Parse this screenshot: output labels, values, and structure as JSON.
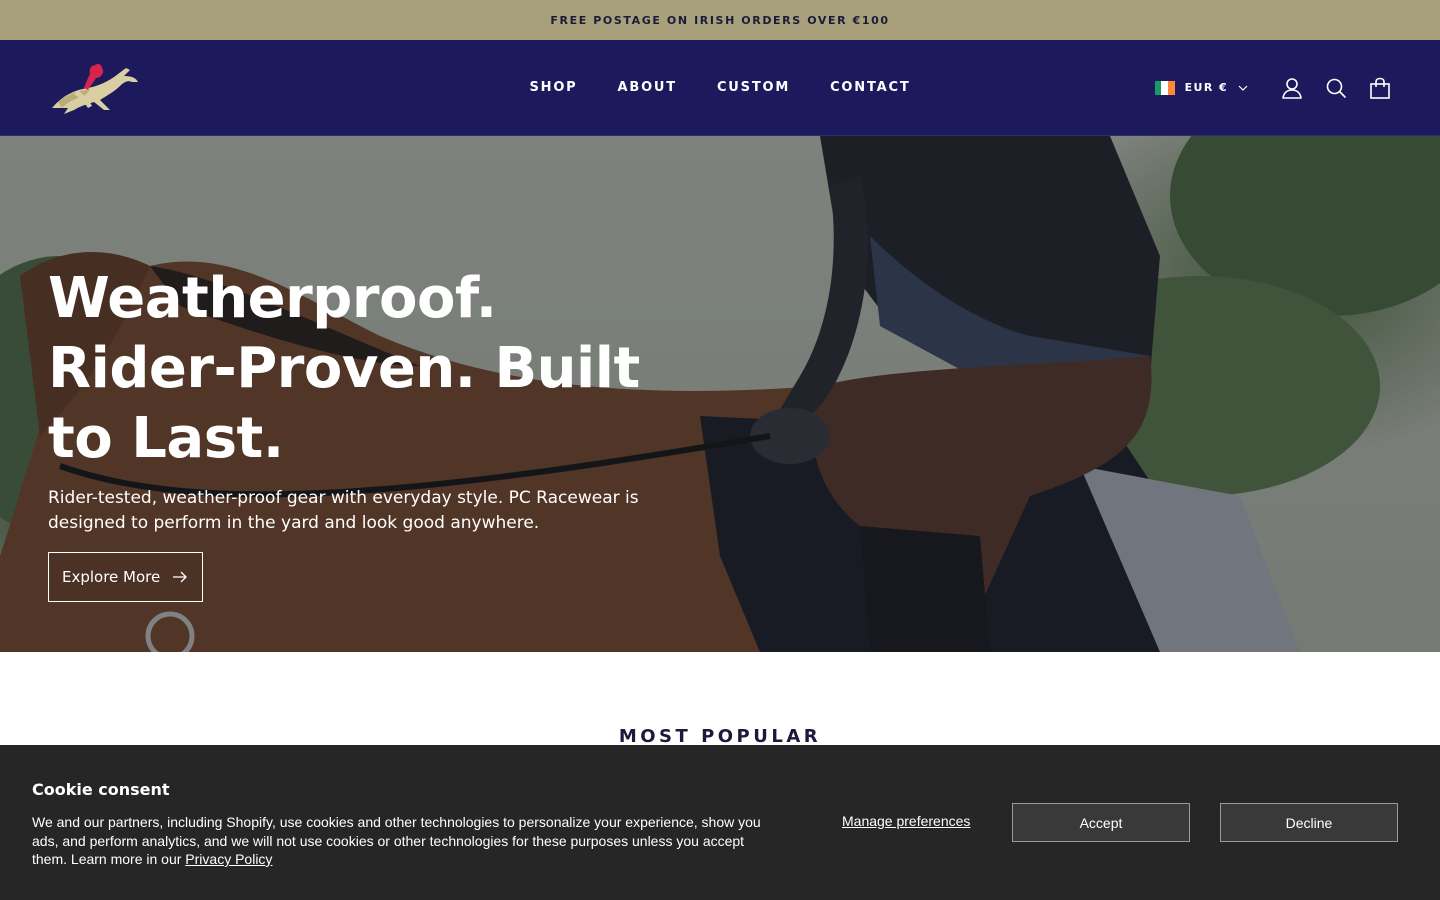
{
  "announcement": {
    "text": "FREE POSTAGE ON IRISH ORDERS OVER €100"
  },
  "header": {
    "logo_icon": "racehorse-jockey-logo",
    "nav": [
      {
        "label": "SHOP"
      },
      {
        "label": "ABOUT"
      },
      {
        "label": "CUSTOM"
      },
      {
        "label": "CONTACT"
      }
    ],
    "currency": {
      "label": "EUR €",
      "flag_colors": [
        "#169b62",
        "#ffffff",
        "#ff883e"
      ]
    },
    "icons": [
      "account-icon",
      "search-icon",
      "cart-icon"
    ]
  },
  "hero": {
    "title": "Weatherproof. Rider-Proven. Built to Last.",
    "subtitle": "Rider-tested, weather-proof gear with everyday style. PC Racewear is designed to perform in the yard and look good anywhere.",
    "button_label": "Explore More",
    "button_icon": "arrow-right-icon"
  },
  "sections": {
    "most_popular": "MOST POPULAR"
  },
  "cookie": {
    "title": "Cookie consent",
    "text": "We and our partners, including Shopify, use cookies and other technologies to personalize your experience, show you ads, and perform analytics, and we will not use cookies or other technologies for these purposes unless you accept them. Learn more in our ",
    "policy_link": "Privacy Policy",
    "manage_label": "Manage preferences",
    "accept_label": "Accept",
    "decline_label": "Decline"
  },
  "colors": {
    "announcement_bg": "#a8a07a",
    "header_bg": "#1c1a5c",
    "cookie_bg": "#262626",
    "brand_accent": "#d6244a"
  }
}
